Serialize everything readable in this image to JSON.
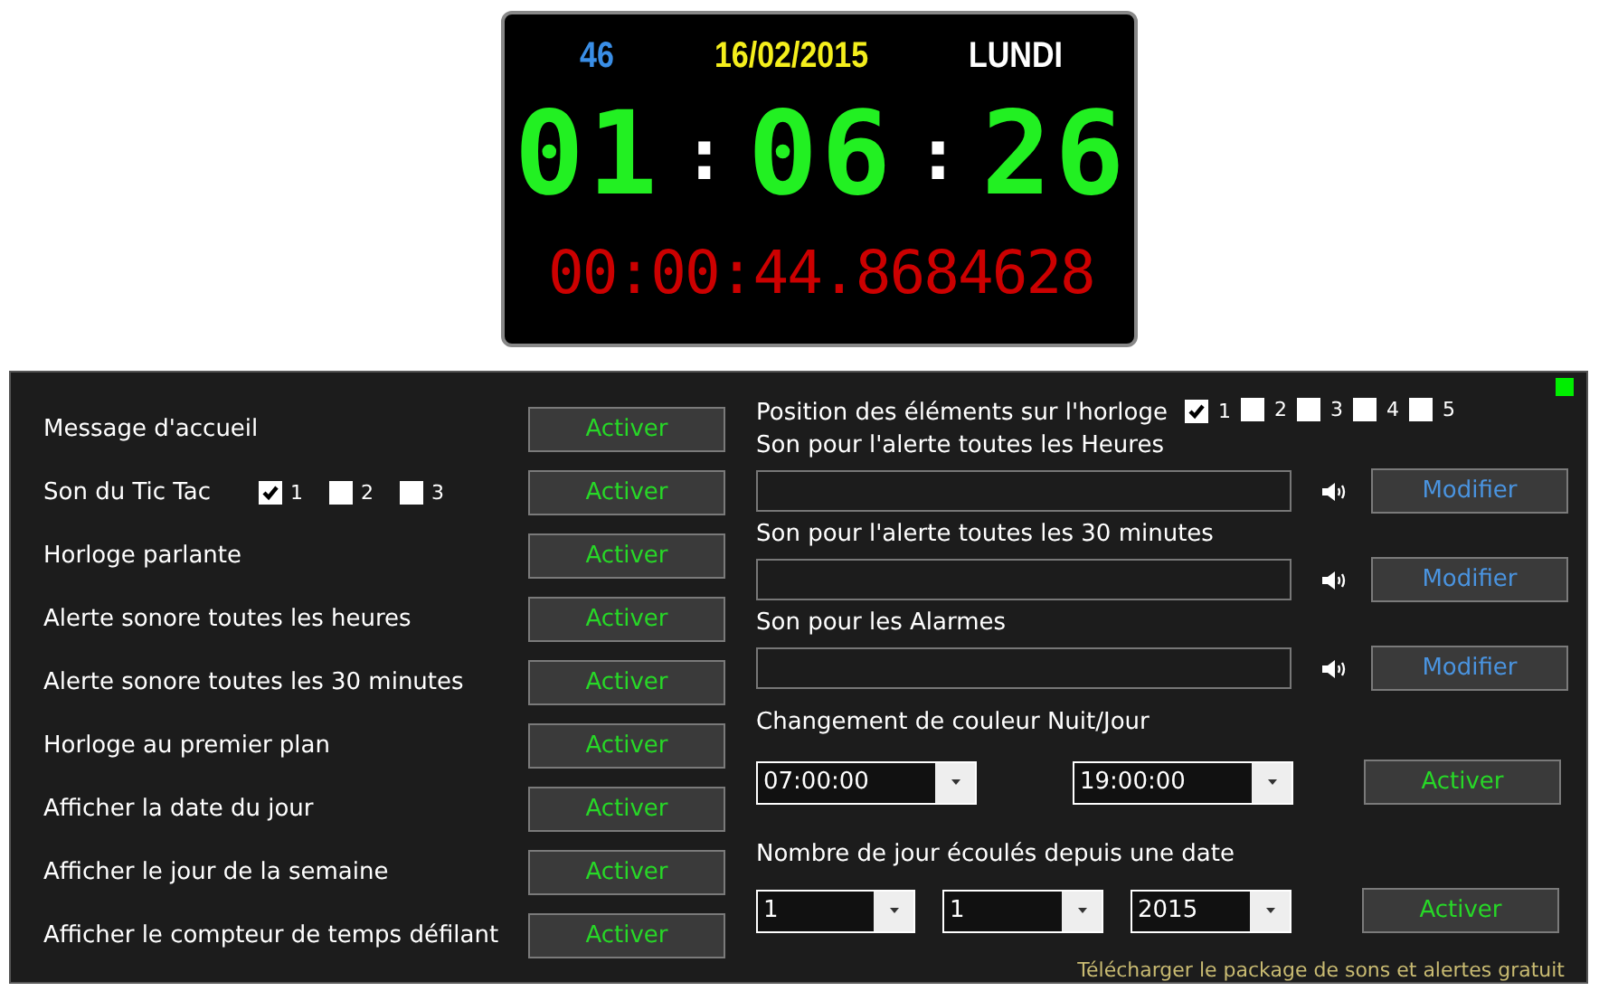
{
  "clock": {
    "week": "46",
    "date": "16/02/2015",
    "weekday": "LUNDI",
    "time": [
      "01",
      ":",
      "06",
      ":",
      "26"
    ],
    "chrono": "00:00:44.8684628"
  },
  "settings": {
    "status": {
      "on": true
    },
    "left_rows": [
      {
        "label": "Message d'accueil",
        "button": "Activer"
      },
      {
        "label": "Son du Tic Tac",
        "options": [
          {
            "label": "1",
            "checked": true
          },
          {
            "label": "2",
            "checked": false
          },
          {
            "label": "3",
            "checked": false
          }
        ],
        "button": "Activer"
      },
      {
        "label": "Horloge parlante",
        "button": "Activer"
      },
      {
        "label": "Alerte sonore toutes les heures",
        "button": "Activer"
      },
      {
        "label": "Alerte sonore toutes les 30 minutes",
        "button": "Activer"
      },
      {
        "label": "Horloge au premier plan",
        "button": "Activer"
      },
      {
        "label": "Afficher la date du jour",
        "button": "Activer"
      },
      {
        "label": "Afficher le jour de la semaine",
        "button": "Activer"
      },
      {
        "label": "Afficher le compteur de temps défilant",
        "button": "Activer"
      }
    ],
    "position": {
      "label": "Position des éléments sur l'horloge",
      "options": [
        {
          "label": "1",
          "checked": true
        },
        {
          "label": "2",
          "checked": false
        },
        {
          "label": "3",
          "checked": false
        },
        {
          "label": "4",
          "checked": false
        },
        {
          "label": "5",
          "checked": false
        }
      ]
    },
    "sounds": [
      {
        "label": "Son pour l'alerte toutes les Heures",
        "button": "Modifier"
      },
      {
        "label": "Son pour l'alerte toutes les 30 minutes",
        "button": "Modifier"
      },
      {
        "label": "Son pour les Alarmes",
        "button": "Modifier"
      }
    ],
    "night_day": {
      "label": "Changement de couleur Nuit/Jour",
      "selects": [
        "07:00:00",
        "19:00:00"
      ],
      "button": "Activer"
    },
    "days_since": {
      "label": "Nombre de jour écoulés depuis une date",
      "selects": [
        "1",
        "1",
        "2015"
      ],
      "button": "Activer"
    },
    "download_link": "Télécharger le package de sons et alertes gratuit"
  }
}
